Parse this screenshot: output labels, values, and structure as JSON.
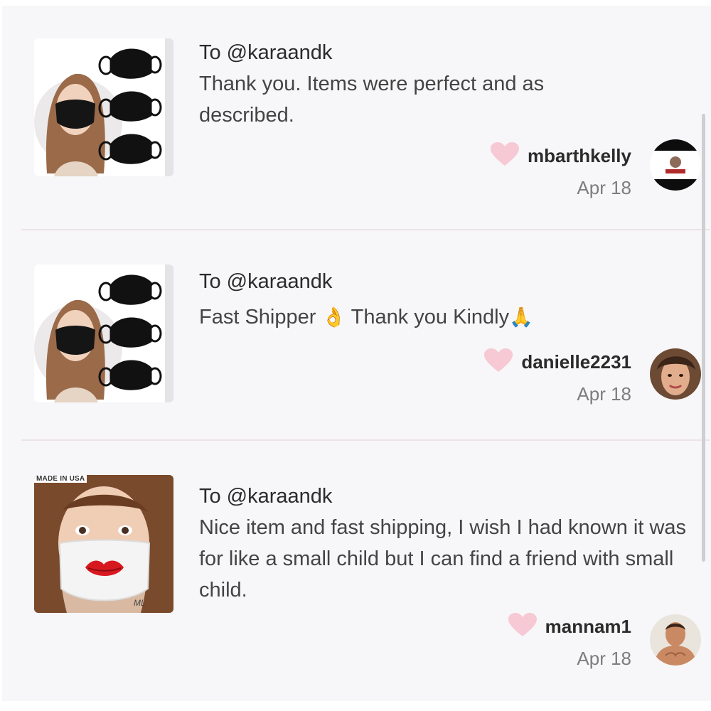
{
  "reviews": [
    {
      "to": "To @karaandk",
      "message_parts": [
        "Thank you. Items were perfect and as described."
      ],
      "username": "mbarthkelly",
      "date": "Apr 18",
      "product": "black-face-masks",
      "avatar": "black-white-logo-avatar"
    },
    {
      "to": "To @karaandk",
      "message_parts": [
        "Fast Shipper ",
        "👌",
        " Thank you Kindly",
        "🙏"
      ],
      "username": "danielle2231",
      "date": "Apr 18",
      "product": "black-face-masks",
      "avatar": "woman-avatar"
    },
    {
      "to": "To @karaandk",
      "message_parts": [
        "Nice item and fast shipping, I wish I had known it was for like a small child but I can find a friend with small child."
      ],
      "username": "mannam1",
      "date": "Apr 18",
      "product": "child-lips-mask",
      "product_badge": "MADE IN USA",
      "avatar": "man-avatar"
    }
  ],
  "colors": {
    "background": "#f7f6f8",
    "heart": "#f6c9d4",
    "divider": "#ece3e7",
    "date": "#7d7d7d"
  }
}
